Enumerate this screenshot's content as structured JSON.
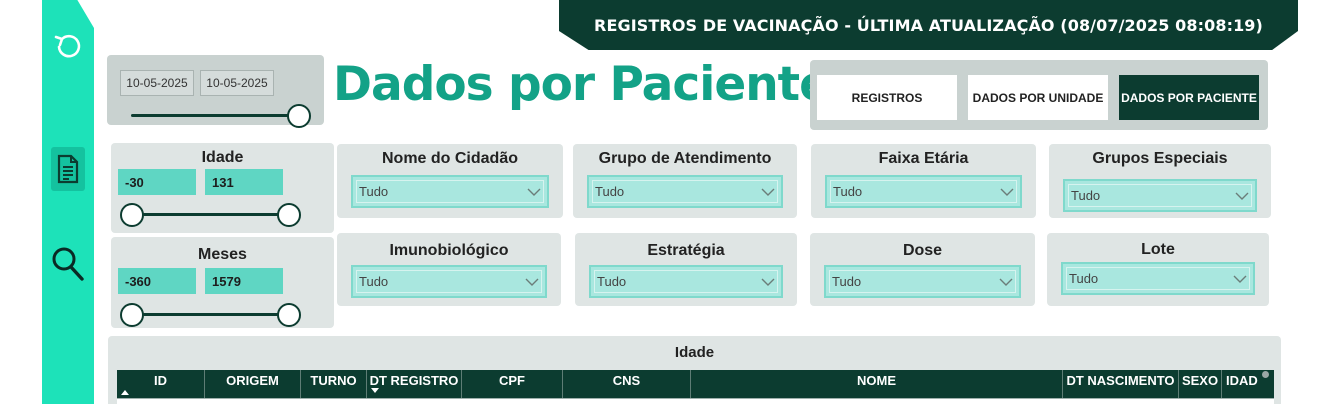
{
  "header": {
    "title": "REGISTROS DE VACINAÇÃO - ÚLTIMA ATUALIZAÇÃO (08/07/2025 08:08:19)"
  },
  "sidebar": {
    "icons": [
      "refresh-icon",
      "report-icon",
      "search-icon"
    ]
  },
  "date_filter": {
    "start": "10-05-2025",
    "end": "10-05-2025",
    "slider_position": 1.0
  },
  "page_title": "Dados por Paciente",
  "nav": {
    "registros": "REGISTROS",
    "dados_por_unidade": "DADOS POR UNIDADE",
    "dados_por_paciente": "DADOS POR PACIENTE",
    "active": "DADOS POR PACIENTE"
  },
  "idade": {
    "label": "Idade",
    "min": "-30",
    "max": "131"
  },
  "meses": {
    "label": "Meses",
    "min": "-360",
    "max": "1579"
  },
  "filters": {
    "nome_cidadao": {
      "label": "Nome do Cidadão",
      "value": "Tudo"
    },
    "grupo_atendimento": {
      "label": "Grupo de Atendimento",
      "value": "Tudo"
    },
    "faixa_etaria": {
      "label": "Faixa Etária",
      "value": "Tudo"
    },
    "grupos_especiais": {
      "label": "Grupos Especiais",
      "value": "Tudo"
    },
    "imunobiologico": {
      "label": "Imunobiológico",
      "value": "Tudo"
    },
    "estrategia": {
      "label": "Estratégia",
      "value": "Tudo"
    },
    "dose": {
      "label": "Dose",
      "value": "Tudo"
    },
    "lote": {
      "label": "Lote",
      "value": "Tudo"
    }
  },
  "table": {
    "title": "Idade",
    "columns": [
      "ID",
      "ORIGEM",
      "TURNO",
      "DT REGISTRO",
      "CPF",
      "CNS",
      "NOME",
      "DT NASCIMENTO",
      "SEXO",
      "IDAD"
    ]
  },
  "colors": {
    "sidebar": "#1de2b9",
    "dark": "#0c3c30",
    "accent_title": "#13a287",
    "dropdown": "#a9e7df"
  }
}
